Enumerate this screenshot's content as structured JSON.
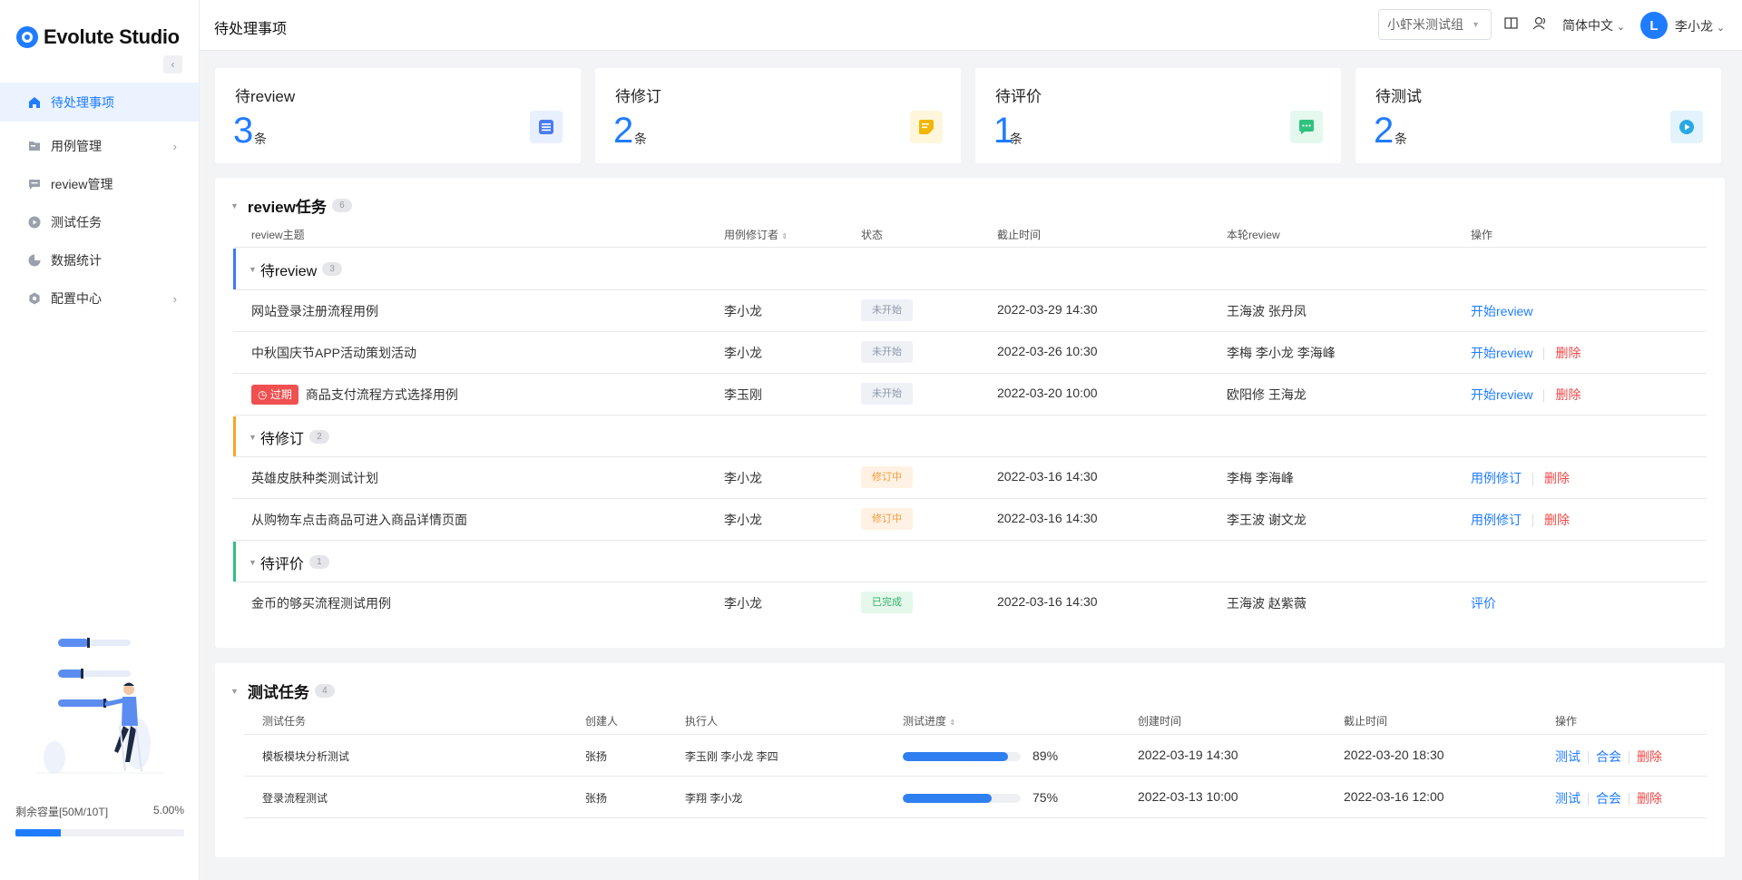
{
  "app": {
    "name": "Evolute Studio"
  },
  "sidebar": {
    "items": [
      {
        "label": "待处理事项",
        "icon": "home-icon"
      },
      {
        "label": "用例管理",
        "icon": "folder-icon"
      },
      {
        "label": "review管理",
        "icon": "comment-icon"
      },
      {
        "label": "测试任务",
        "icon": "play-circle-icon"
      },
      {
        "label": "数据统计",
        "icon": "pie-chart-icon"
      },
      {
        "label": "配置中心",
        "icon": "settings-icon"
      }
    ],
    "storage": {
      "label": "剩余容量[50M/10T]",
      "percent_text": "5.00%",
      "fill_fraction": 0.27
    }
  },
  "header": {
    "title": "待处理事项",
    "team": "小虾米测试组",
    "language": "简体中文",
    "avatar_letter": "L",
    "user": "李小龙"
  },
  "stats": [
    {
      "label": "待review",
      "value": "3",
      "unit": "条",
      "color": "#4a7cf0",
      "bg": "#e8efff"
    },
    {
      "label": "待修订",
      "value": "2",
      "unit": "条",
      "color": "#f2b705",
      "bg": "#fff6dc"
    },
    {
      "label": "待评价",
      "value": "1",
      "unit": "条",
      "color": "#2ec27e",
      "bg": "#e4f8ee"
    },
    {
      "label": "待测试",
      "value": "2",
      "unit": "条",
      "color": "#29a8e6",
      "bg": "#e2f3fc"
    }
  ],
  "review": {
    "title": "review任务",
    "count": "6",
    "columns": [
      "review主题",
      "用例修订者",
      "状态",
      "截止时间",
      "本轮review",
      "操作"
    ],
    "groups": [
      {
        "name": "待review",
        "count": "3",
        "color": "#3d7bf5"
      },
      {
        "name": "待修订",
        "count": "2",
        "color": "#f5a623"
      },
      {
        "name": "待评价",
        "count": "1",
        "color": "#2ec27e"
      }
    ],
    "rows": [
      {
        "topic": "网站登录注册流程用例",
        "owner": "李小龙",
        "status": "未开始",
        "deadline": "2022-03-29  14:30",
        "reviewers": "王海波    张丹凤",
        "action": "开始review",
        "del": ""
      },
      {
        "topic": "中秋国庆节APP活动策划活动",
        "owner": "李小龙",
        "status": "未开始",
        "deadline": "2022-03-26  10:30",
        "reviewers": "李梅    李小龙    李海峰",
        "action": "开始review",
        "del": "删除"
      },
      {
        "topic": "商品支付流程方式选择用例",
        "overdue": "过期",
        "owner": "李玉刚",
        "status": "未开始",
        "deadline": "2022-03-20  10:00",
        "reviewers": "欧阳修    王海龙",
        "action": "开始review",
        "del": "删除"
      },
      {
        "topic": "英雄皮肤种类测试计划",
        "owner": "李小龙",
        "status": "修订中",
        "deadline": "2022-03-16  14:30",
        "reviewers": "李梅    李海峰",
        "action": "用例修订",
        "del": "删除"
      },
      {
        "topic": "从购物车点击商品可进入商品详情页面",
        "owner": "李小龙",
        "status": "修订中",
        "deadline": "2022-03-16  14:30",
        "reviewers": "李王波   谢文龙",
        "action": "用例修订",
        "del": "删除"
      },
      {
        "topic": "金币的够买流程测试用例",
        "owner": "李小龙",
        "status": "已完成",
        "deadline": "2022-03-16  14:30",
        "reviewers": "王海波    赵紫薇",
        "action": "评价",
        "del": ""
      }
    ]
  },
  "tasks": {
    "title": "测试任务",
    "count": "4",
    "columns": [
      "测试任务",
      "创建人",
      "执行人",
      "测试进度",
      "创建时间",
      "截止时间",
      "操作"
    ],
    "rows": [
      {
        "name": "模板模块分析测试",
        "creator": "张扬",
        "executors": "李玉刚  李小龙  李四",
        "progress": 89,
        "progress_text": "89%",
        "created": "2022-03-19  14:30",
        "deadline": "2022-03-20  18:30",
        "a1": "测试",
        "a2": "合会",
        "a3": "删除"
      },
      {
        "name": "登录流程测试",
        "creator": "张扬",
        "executors": "李翔  李小龙",
        "progress": 75,
        "progress_text": "75%",
        "created": "2022-03-13  10:00",
        "deadline": "2022-03-16  12:00",
        "a1": "测试",
        "a2": "合会",
        "a3": "删除"
      }
    ]
  }
}
